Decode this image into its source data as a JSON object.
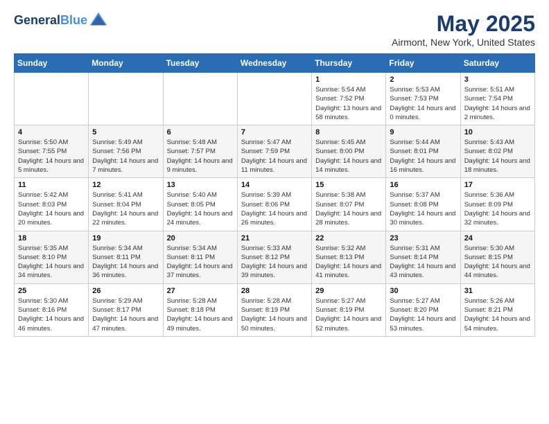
{
  "header": {
    "logo_line1": "General",
    "logo_line2": "Blue",
    "month": "May 2025",
    "location": "Airmont, New York, United States"
  },
  "weekdays": [
    "Sunday",
    "Monday",
    "Tuesday",
    "Wednesday",
    "Thursday",
    "Friday",
    "Saturday"
  ],
  "weeks": [
    [
      {
        "day": "",
        "info": ""
      },
      {
        "day": "",
        "info": ""
      },
      {
        "day": "",
        "info": ""
      },
      {
        "day": "",
        "info": ""
      },
      {
        "day": "1",
        "info": "Sunrise: 5:54 AM\nSunset: 7:52 PM\nDaylight: 13 hours and 58 minutes."
      },
      {
        "day": "2",
        "info": "Sunrise: 5:53 AM\nSunset: 7:53 PM\nDaylight: 14 hours and 0 minutes."
      },
      {
        "day": "3",
        "info": "Sunrise: 5:51 AM\nSunset: 7:54 PM\nDaylight: 14 hours and 2 minutes."
      }
    ],
    [
      {
        "day": "4",
        "info": "Sunrise: 5:50 AM\nSunset: 7:55 PM\nDaylight: 14 hours and 5 minutes."
      },
      {
        "day": "5",
        "info": "Sunrise: 5:49 AM\nSunset: 7:56 PM\nDaylight: 14 hours and 7 minutes."
      },
      {
        "day": "6",
        "info": "Sunrise: 5:48 AM\nSunset: 7:57 PM\nDaylight: 14 hours and 9 minutes."
      },
      {
        "day": "7",
        "info": "Sunrise: 5:47 AM\nSunset: 7:59 PM\nDaylight: 14 hours and 11 minutes."
      },
      {
        "day": "8",
        "info": "Sunrise: 5:45 AM\nSunset: 8:00 PM\nDaylight: 14 hours and 14 minutes."
      },
      {
        "day": "9",
        "info": "Sunrise: 5:44 AM\nSunset: 8:01 PM\nDaylight: 14 hours and 16 minutes."
      },
      {
        "day": "10",
        "info": "Sunrise: 5:43 AM\nSunset: 8:02 PM\nDaylight: 14 hours and 18 minutes."
      }
    ],
    [
      {
        "day": "11",
        "info": "Sunrise: 5:42 AM\nSunset: 8:03 PM\nDaylight: 14 hours and 20 minutes."
      },
      {
        "day": "12",
        "info": "Sunrise: 5:41 AM\nSunset: 8:04 PM\nDaylight: 14 hours and 22 minutes."
      },
      {
        "day": "13",
        "info": "Sunrise: 5:40 AM\nSunset: 8:05 PM\nDaylight: 14 hours and 24 minutes."
      },
      {
        "day": "14",
        "info": "Sunrise: 5:39 AM\nSunset: 8:06 PM\nDaylight: 14 hours and 26 minutes."
      },
      {
        "day": "15",
        "info": "Sunrise: 5:38 AM\nSunset: 8:07 PM\nDaylight: 14 hours and 28 minutes."
      },
      {
        "day": "16",
        "info": "Sunrise: 5:37 AM\nSunset: 8:08 PM\nDaylight: 14 hours and 30 minutes."
      },
      {
        "day": "17",
        "info": "Sunrise: 5:36 AM\nSunset: 8:09 PM\nDaylight: 14 hours and 32 minutes."
      }
    ],
    [
      {
        "day": "18",
        "info": "Sunrise: 5:35 AM\nSunset: 8:10 PM\nDaylight: 14 hours and 34 minutes."
      },
      {
        "day": "19",
        "info": "Sunrise: 5:34 AM\nSunset: 8:11 PM\nDaylight: 14 hours and 36 minutes."
      },
      {
        "day": "20",
        "info": "Sunrise: 5:34 AM\nSunset: 8:11 PM\nDaylight: 14 hours and 37 minutes."
      },
      {
        "day": "21",
        "info": "Sunrise: 5:33 AM\nSunset: 8:12 PM\nDaylight: 14 hours and 39 minutes."
      },
      {
        "day": "22",
        "info": "Sunrise: 5:32 AM\nSunset: 8:13 PM\nDaylight: 14 hours and 41 minutes."
      },
      {
        "day": "23",
        "info": "Sunrise: 5:31 AM\nSunset: 8:14 PM\nDaylight: 14 hours and 43 minutes."
      },
      {
        "day": "24",
        "info": "Sunrise: 5:30 AM\nSunset: 8:15 PM\nDaylight: 14 hours and 44 minutes."
      }
    ],
    [
      {
        "day": "25",
        "info": "Sunrise: 5:30 AM\nSunset: 8:16 PM\nDaylight: 14 hours and 46 minutes."
      },
      {
        "day": "26",
        "info": "Sunrise: 5:29 AM\nSunset: 8:17 PM\nDaylight: 14 hours and 47 minutes."
      },
      {
        "day": "27",
        "info": "Sunrise: 5:28 AM\nSunset: 8:18 PM\nDaylight: 14 hours and 49 minutes."
      },
      {
        "day": "28",
        "info": "Sunrise: 5:28 AM\nSunset: 8:19 PM\nDaylight: 14 hours and 50 minutes."
      },
      {
        "day": "29",
        "info": "Sunrise: 5:27 AM\nSunset: 8:19 PM\nDaylight: 14 hours and 52 minutes."
      },
      {
        "day": "30",
        "info": "Sunrise: 5:27 AM\nSunset: 8:20 PM\nDaylight: 14 hours and 53 minutes."
      },
      {
        "day": "31",
        "info": "Sunrise: 5:26 AM\nSunset: 8:21 PM\nDaylight: 14 hours and 54 minutes."
      }
    ]
  ]
}
